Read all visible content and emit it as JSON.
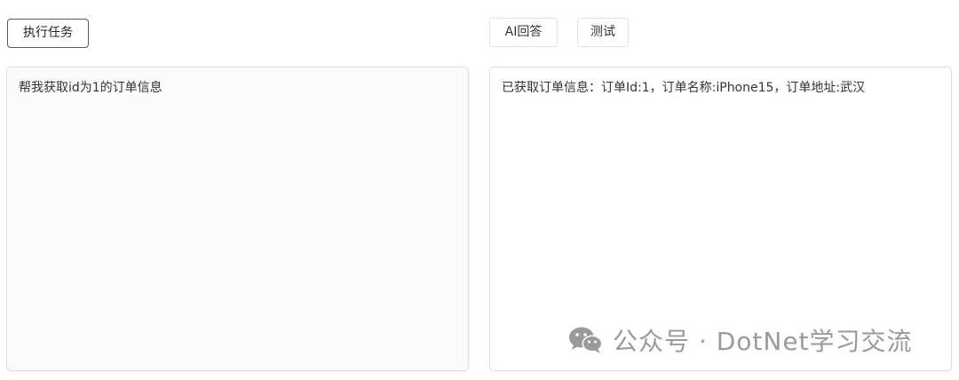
{
  "toolbar": {
    "execute_task_label": "执行任务",
    "ai_answer_label": "AI回答",
    "test_label": "测试"
  },
  "input_panel": {
    "value": "帮我获取id为1的订单信息"
  },
  "output_panel": {
    "value": "已获取订单信息：订单Id:1，订单名称:iPhone15，订单地址:武汉"
  },
  "watermark": {
    "icon": "wechat-icon",
    "text": "公众号 · DotNet学习交流"
  }
}
